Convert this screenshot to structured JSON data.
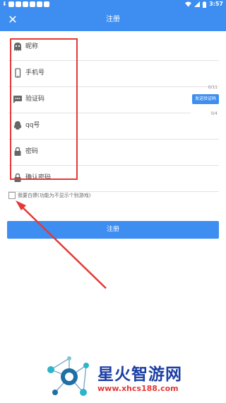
{
  "status_bar": {
    "time": "3:57"
  },
  "appbar": {
    "title": "注册",
    "close_icon": "✕"
  },
  "form": {
    "nickname": "昵称",
    "phone": "手机号",
    "phone_counter": "0/11",
    "verify_code": "验证码",
    "send_code": "发送验证码",
    "code_counter": "0/4",
    "qq": "qq号",
    "password": "密码",
    "confirm_password": "确认密码"
  },
  "agree": {
    "text": "我要白嫖(功能为不显示个别游戏)"
  },
  "register_button": "注册",
  "colors": {
    "primary": "#3d8ef0",
    "annotation": "#e53935"
  },
  "watermark": {
    "brand": "星火智游网",
    "url": "www.xhcs188.com"
  }
}
